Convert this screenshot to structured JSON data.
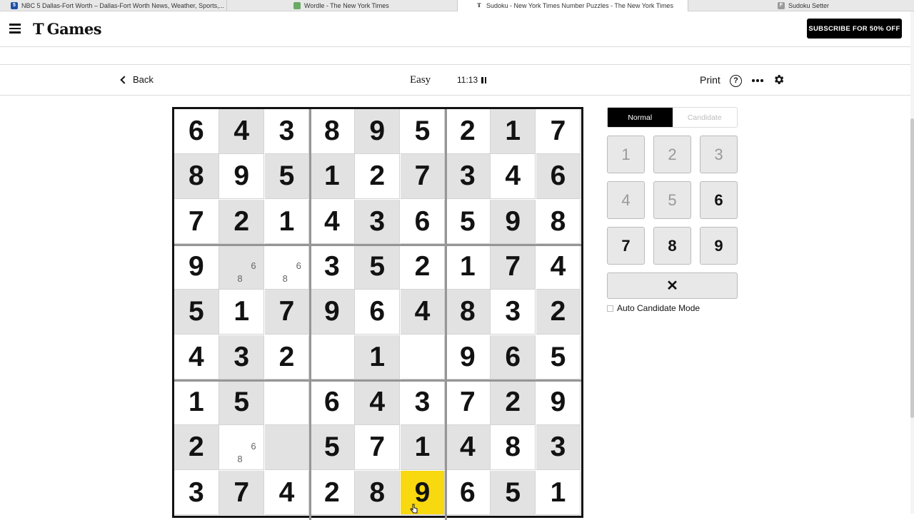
{
  "browser": {
    "tabs": [
      {
        "title": "NBC 5 Dallas-Fort Worth – Dallas-Fort Worth News, Weather, Sports,...",
        "icon": "nbc-favicon",
        "active": false
      },
      {
        "title": "Wordle - The New York Times",
        "icon": "wordle-favicon",
        "active": false
      },
      {
        "title": "Sudoku - New York Times Number Puzzles - The New York Times",
        "icon": "nyt-favicon",
        "active": true
      },
      {
        "title": "Sudoku Setter",
        "icon": "sudoku-setter-favicon",
        "active": false
      }
    ]
  },
  "header": {
    "logo_mark": "T",
    "logo_text": "Games",
    "subscribe_label": "SUBSCRIBE FOR 50% OFF"
  },
  "toolbar": {
    "back_label": "Back",
    "difficulty": "Easy",
    "timer": "11:13",
    "print_label": "Print",
    "help_label": "?"
  },
  "board": {
    "rows": [
      [
        "6",
        "4",
        "3",
        "8",
        "9",
        "5",
        "2",
        "1",
        "7"
      ],
      [
        "8",
        "9",
        "5",
        "1",
        "2",
        "7",
        "3",
        "4",
        "6"
      ],
      [
        "7",
        "2",
        "1",
        "4",
        "3",
        "6",
        "5",
        "9",
        "8"
      ],
      [
        "9",
        "",
        "",
        "3",
        "5",
        "2",
        "1",
        "7",
        "4"
      ],
      [
        "5",
        "1",
        "7",
        "9",
        "6",
        "4",
        "8",
        "3",
        "2"
      ],
      [
        "4",
        "3",
        "2",
        "",
        "1",
        "",
        "9",
        "6",
        "5"
      ],
      [
        "1",
        "5",
        "",
        "6",
        "4",
        "3",
        "7",
        "2",
        "9"
      ],
      [
        "2",
        "",
        "",
        "5",
        "7",
        "1",
        "4",
        "8",
        "3"
      ],
      [
        "3",
        "7",
        "4",
        "2",
        "8",
        "9",
        "6",
        "5",
        "1"
      ]
    ],
    "candidates": [
      {
        "row": 3,
        "col": 1,
        "values": [
          "6",
          "8"
        ]
      },
      {
        "row": 3,
        "col": 2,
        "values": [
          "6",
          "8"
        ]
      },
      {
        "row": 7,
        "col": 1,
        "values": [
          "6",
          "8"
        ]
      }
    ],
    "selected": {
      "row": 8,
      "col": 5
    },
    "selected_color": "#f8d80e",
    "shade_color": "#e2e2e2"
  },
  "panel": {
    "mode_normal": "Normal",
    "mode_candidate": "Candidate",
    "numpad": [
      "1",
      "2",
      "3",
      "4",
      "5",
      "6",
      "7",
      "8",
      "9"
    ],
    "numpad_used": [
      "1",
      "2",
      "3",
      "4",
      "5"
    ],
    "erase_label": "✕",
    "auto_candidate_label": "Auto Candidate Mode"
  }
}
